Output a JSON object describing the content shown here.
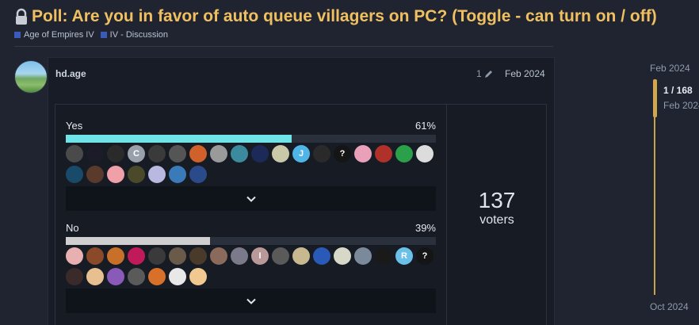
{
  "topic": {
    "title": "Poll: Are you in favor of auto queue villagers on PC? (Toggle - can turn on / off)",
    "categories": [
      {
        "label": "Age of Empires IV",
        "color": "#3a5bb8"
      },
      {
        "label": "IV - Discussion",
        "color": "#3a5bb8"
      }
    ]
  },
  "post": {
    "username": "hd.age",
    "edit_count": "1",
    "date": "Feb 2024"
  },
  "poll": {
    "options": [
      {
        "label": "Yes",
        "percent_text": "61%",
        "percent": 61,
        "bar_color": "#6fe3e8",
        "voter_avatars": [
          {
            "bg": "#4a4a4a",
            "t": ""
          },
          {
            "bg": "#1b1b2a",
            "t": ""
          },
          {
            "bg": "#2a2a2a",
            "t": ""
          },
          {
            "bg": "#9aa0aa",
            "t": "C"
          },
          {
            "bg": "#3a3a3a",
            "t": ""
          },
          {
            "bg": "#555",
            "t": ""
          },
          {
            "bg": "#d0612b",
            "t": ""
          },
          {
            "bg": "#9a9a9a",
            "t": ""
          },
          {
            "bg": "#3c8a9e",
            "t": ""
          },
          {
            "bg": "#1c2a5a",
            "t": ""
          },
          {
            "bg": "#c9c9a9",
            "t": ""
          },
          {
            "bg": "#4fb4e8",
            "t": "J"
          },
          {
            "bg": "#2a2a2a",
            "t": ""
          },
          {
            "bg": "#151515",
            "t": "?"
          },
          {
            "bg": "#e9a0b8",
            "t": ""
          },
          {
            "bg": "#b0302a",
            "t": ""
          },
          {
            "bg": "#2aa04a",
            "t": ""
          },
          {
            "bg": "#dcdcdc",
            "t": ""
          },
          {
            "bg": "#1a4a6a",
            "t": ""
          },
          {
            "bg": "#5a3a2a",
            "t": ""
          },
          {
            "bg": "#f0a0a8",
            "t": ""
          },
          {
            "bg": "#4a4a2a",
            "t": ""
          },
          {
            "bg": "#b8b8e0",
            "t": ""
          },
          {
            "bg": "#3a7ab8",
            "t": ""
          },
          {
            "bg": "#2a4a8a",
            "t": ""
          }
        ]
      },
      {
        "label": "No",
        "percent_text": "39%",
        "percent": 39,
        "bar_color": "#cfcfcf",
        "voter_avatars": [
          {
            "bg": "#e8b0b0",
            "t": ""
          },
          {
            "bg": "#8a4a2a",
            "t": ""
          },
          {
            "bg": "#c8702a",
            "t": ""
          },
          {
            "bg": "#c01a5a",
            "t": ""
          },
          {
            "bg": "#3a3a3a",
            "t": ""
          },
          {
            "bg": "#6a5a4a",
            "t": ""
          },
          {
            "bg": "#4a3a2a",
            "t": ""
          },
          {
            "bg": "#8a6a5a",
            "t": ""
          },
          {
            "bg": "#7a7a8a",
            "t": ""
          },
          {
            "bg": "#b89898",
            "t": "I"
          },
          {
            "bg": "#5a5a5a",
            "t": ""
          },
          {
            "bg": "#c8b890",
            "t": ""
          },
          {
            "bg": "#2a5ab8",
            "t": ""
          },
          {
            "bg": "#d8d8c8",
            "t": ""
          },
          {
            "bg": "#7a8a9a",
            "t": ""
          },
          {
            "bg": "#1a1a1a",
            "t": ""
          },
          {
            "bg": "#6ac0e8",
            "t": "R"
          },
          {
            "bg": "#151515",
            "t": "?"
          },
          {
            "bg": "#3a2a2a",
            "t": ""
          },
          {
            "bg": "#e8c090",
            "t": ""
          },
          {
            "bg": "#8a5ab8",
            "t": ""
          },
          {
            "bg": "#5a5a5a",
            "t": ""
          },
          {
            "bg": "#d8702a",
            "t": ""
          },
          {
            "bg": "#e8e8e8",
            "t": ""
          },
          {
            "bg": "#f0c890",
            "t": ""
          }
        ]
      }
    ],
    "voters_count": "137",
    "voters_label": "voters"
  },
  "timeline": {
    "top_date": "Feb 2024",
    "current_position": "1 / 168",
    "current_date": "Feb 2024",
    "bottom_date": "Oct 2024"
  }
}
